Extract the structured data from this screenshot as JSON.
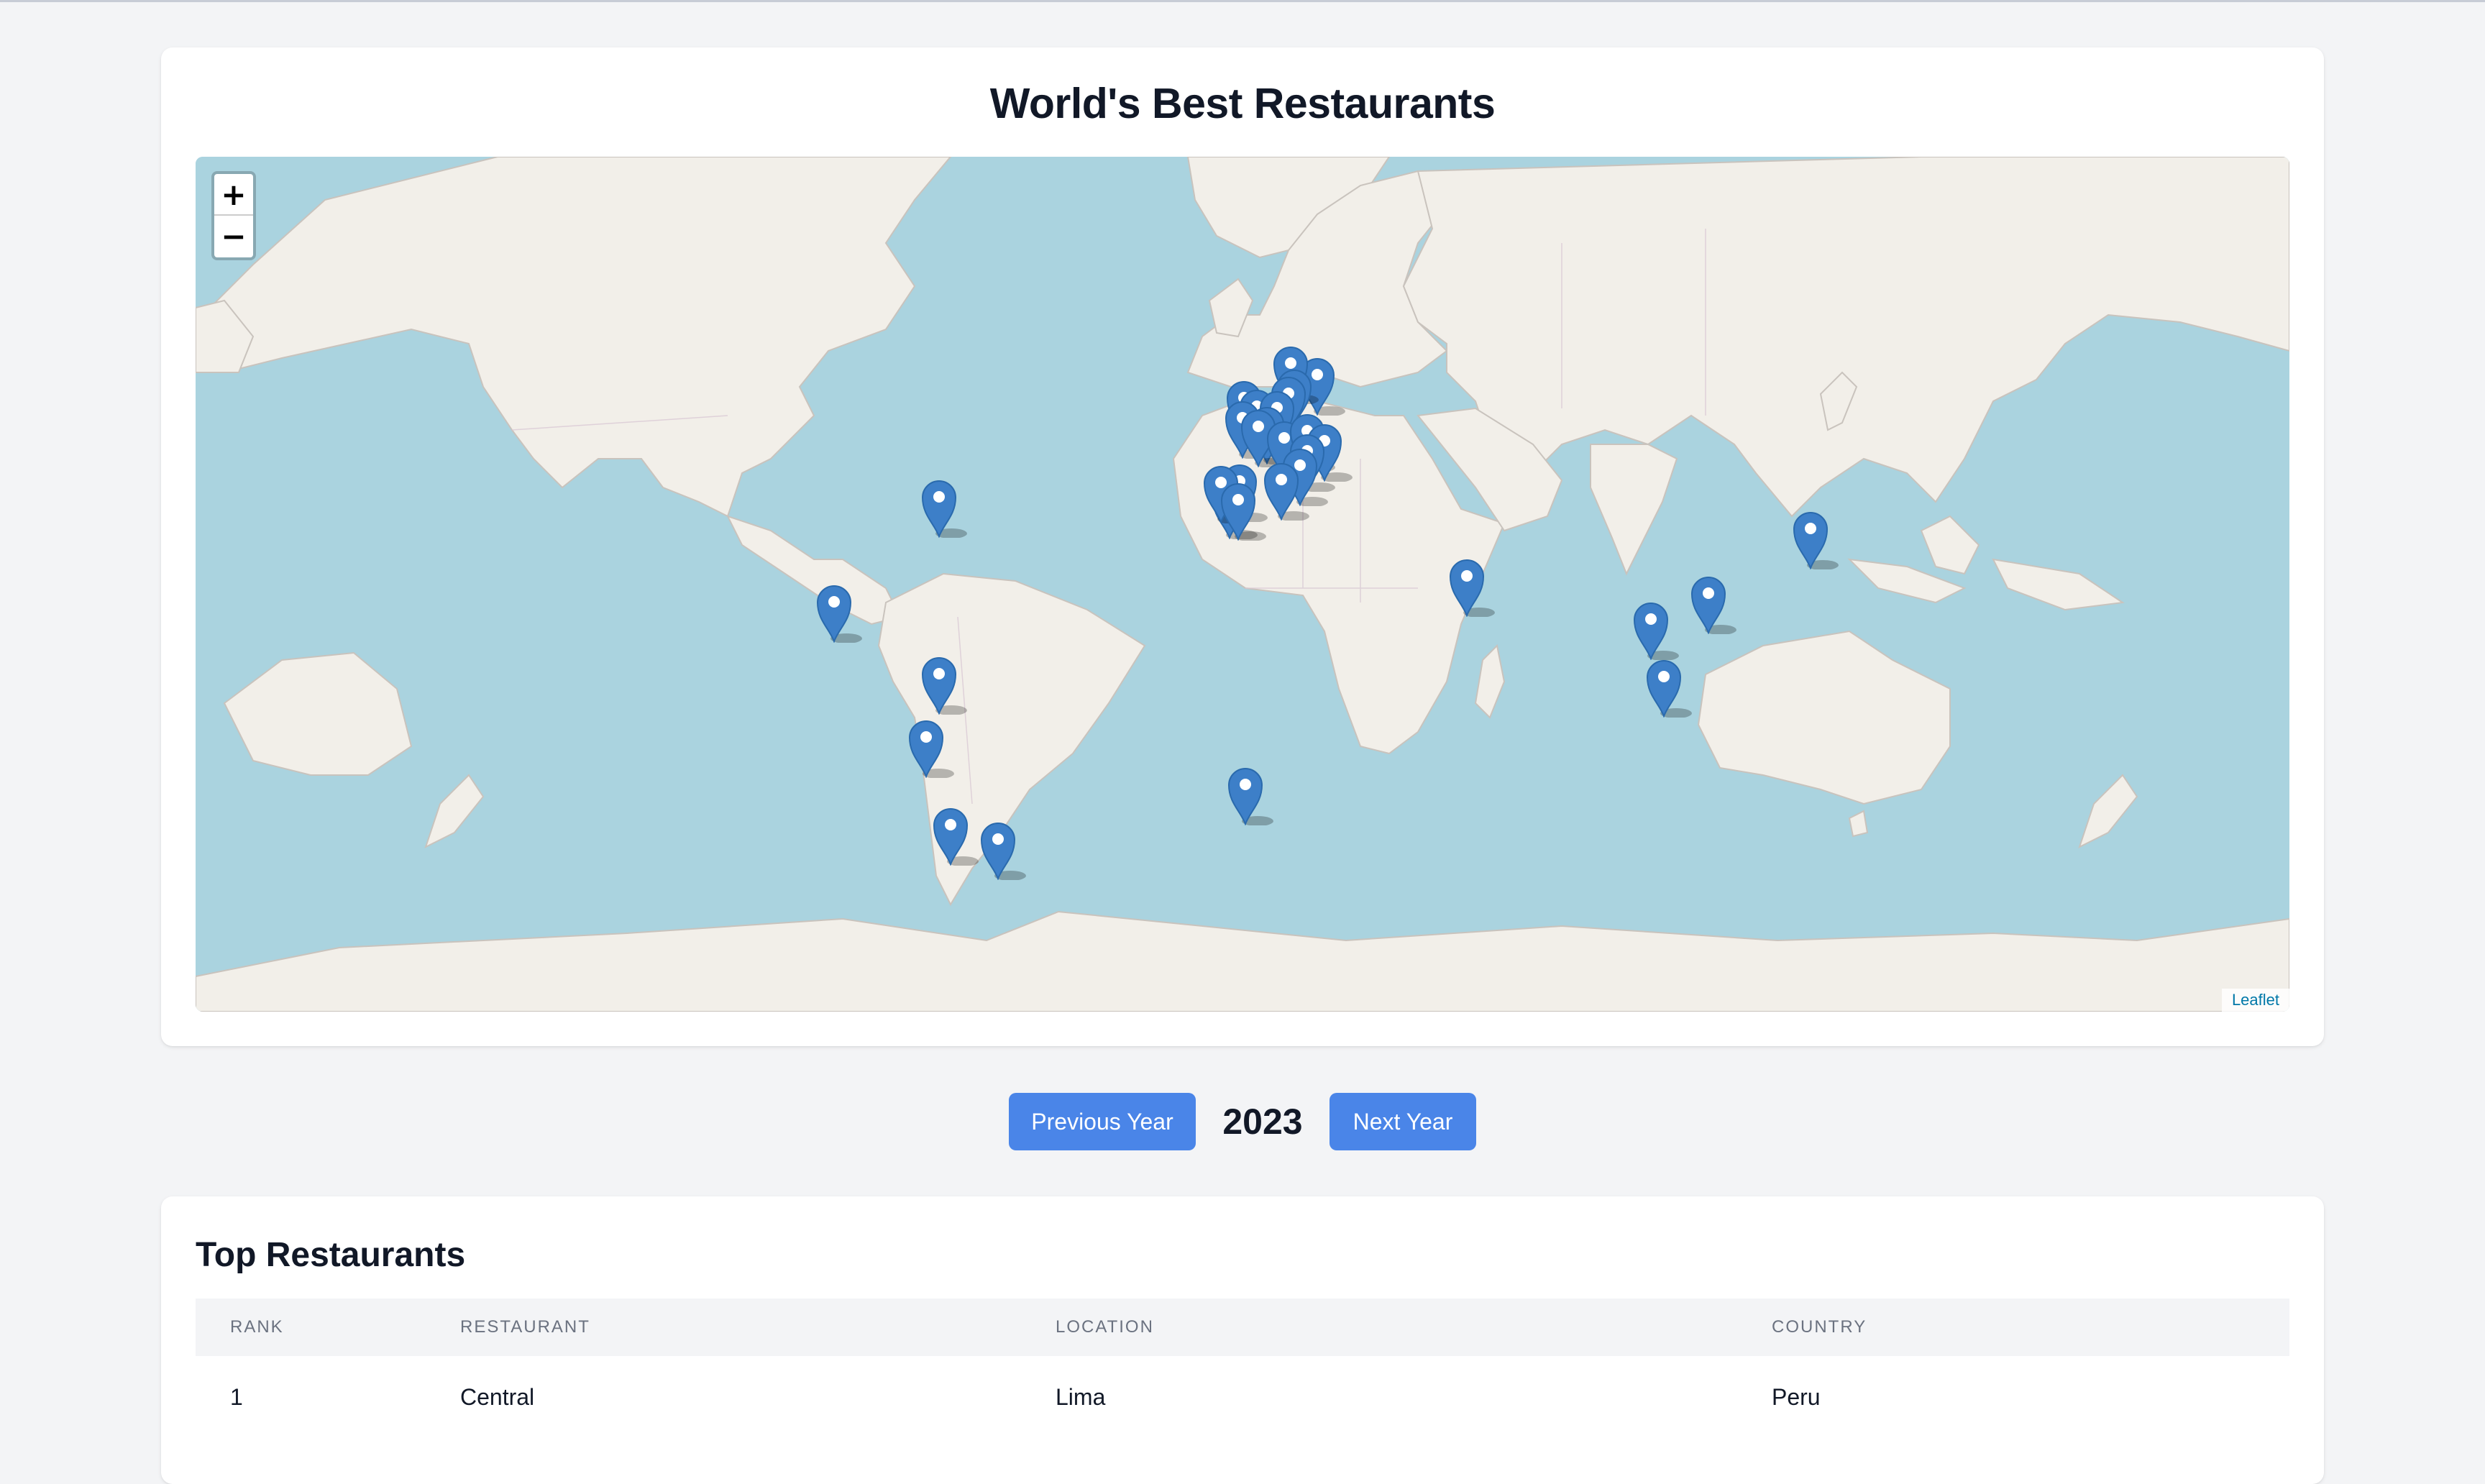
{
  "title": "World's Best Restaurants",
  "map": {
    "zoom_in_label": "+",
    "zoom_out_label": "−",
    "attribution": "Leaflet"
  },
  "year_nav": {
    "prev_label": "Previous Year",
    "year": "2023",
    "next_label": "Next Year"
  },
  "table": {
    "title": "Top Restaurants",
    "columns": [
      "RANK",
      "RESTAURANT",
      "LOCATION",
      "COUNTRY"
    ],
    "rows": [
      {
        "rank": "1",
        "restaurant": "Central",
        "location": "Lima",
        "country": "Peru"
      }
    ]
  },
  "colors": {
    "accent": "#4a85e8",
    "water": "#aad3df",
    "land": "#f2efe9",
    "marker": "#3d7fc8"
  }
}
